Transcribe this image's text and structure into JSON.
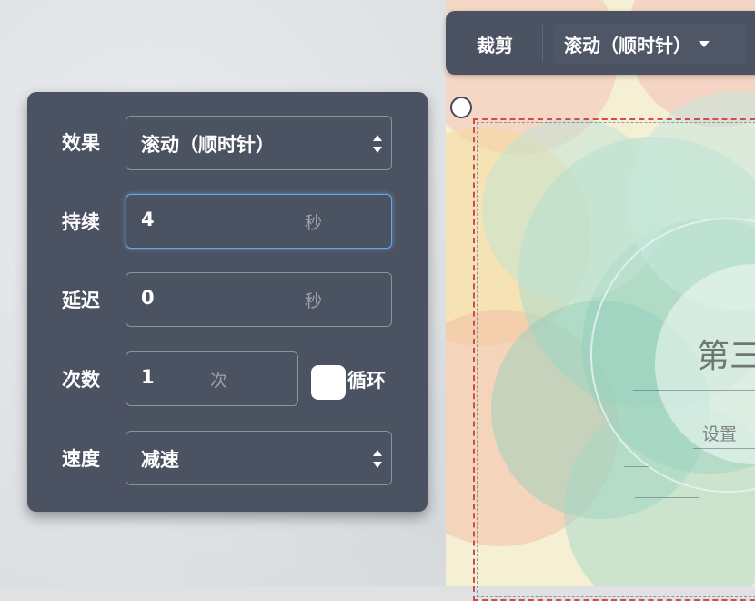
{
  "toolbar": {
    "crop_label": "裁剪",
    "effect_label": "滚动（顺时针）",
    "caret_icon": "caret-down-icon"
  },
  "panel": {
    "effect": {
      "label": "效果",
      "value": "滚动（顺时针）"
    },
    "duration": {
      "label": "持续",
      "value": "4",
      "unit": "秒"
    },
    "delay": {
      "label": "延迟",
      "value": "0",
      "unit": "秒"
    },
    "count": {
      "label": "次数",
      "value": "1",
      "unit": "次",
      "loop_label": "循环",
      "loop_checked": false
    },
    "speed": {
      "label": "速度",
      "value": "减速"
    }
  },
  "slide": {
    "title": "第三",
    "subtitle": "设置"
  },
  "colors": {
    "panel_bg": "#4b5261",
    "focus_border": "#6ea7e6",
    "selection_dash": "#d14b4b"
  }
}
